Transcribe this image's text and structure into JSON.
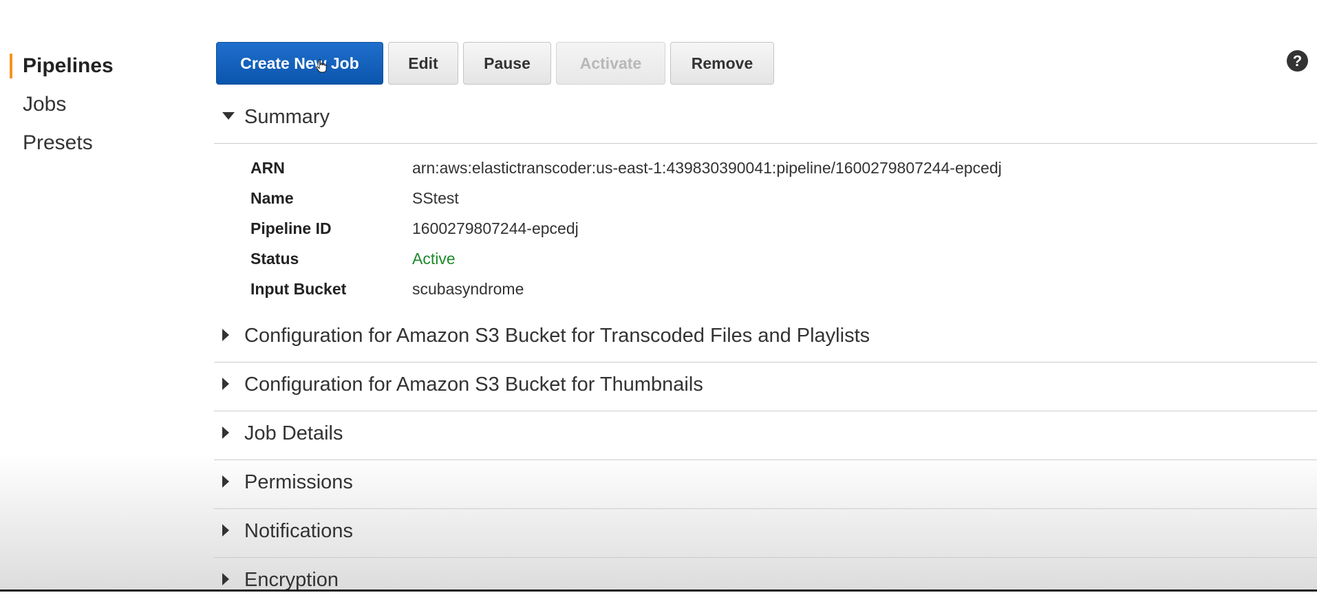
{
  "sidebar": {
    "items": [
      {
        "label": "Pipelines",
        "active": true
      },
      {
        "label": "Jobs",
        "active": false
      },
      {
        "label": "Presets",
        "active": false
      }
    ]
  },
  "toolbar": {
    "create_label": "Create New Job",
    "edit_label": "Edit",
    "pause_label": "Pause",
    "activate_label": "Activate",
    "remove_label": "Remove"
  },
  "help": {
    "icon": "help-icon",
    "glyph": "?"
  },
  "summary": {
    "title": "Summary",
    "expanded": true,
    "rows": [
      {
        "key": "ARN",
        "value": "arn:aws:elastictranscoder:us-east-1:439830390041:pipeline/1600279807244-epcedj"
      },
      {
        "key": "Name",
        "value": "SStest"
      },
      {
        "key": "Pipeline ID",
        "value": "1600279807244-epcedj"
      },
      {
        "key": "Status",
        "value": "Active"
      },
      {
        "key": "Input Bucket",
        "value": "scubasyndrome"
      }
    ]
  },
  "sections": [
    {
      "title": "Configuration for Amazon S3 Bucket for Transcoded Files and Playlists",
      "expanded": false
    },
    {
      "title": "Configuration for Amazon S3 Bucket for Thumbnails",
      "expanded": false
    },
    {
      "title": "Job Details",
      "expanded": false
    },
    {
      "title": "Permissions",
      "expanded": false
    },
    {
      "title": "Notifications",
      "expanded": false
    },
    {
      "title": "Encryption",
      "expanded": false
    }
  ],
  "colors": {
    "primary_button": "#0b55ad",
    "active_nav_marker": "#f7931e",
    "status_active": "#1d8a2b"
  }
}
